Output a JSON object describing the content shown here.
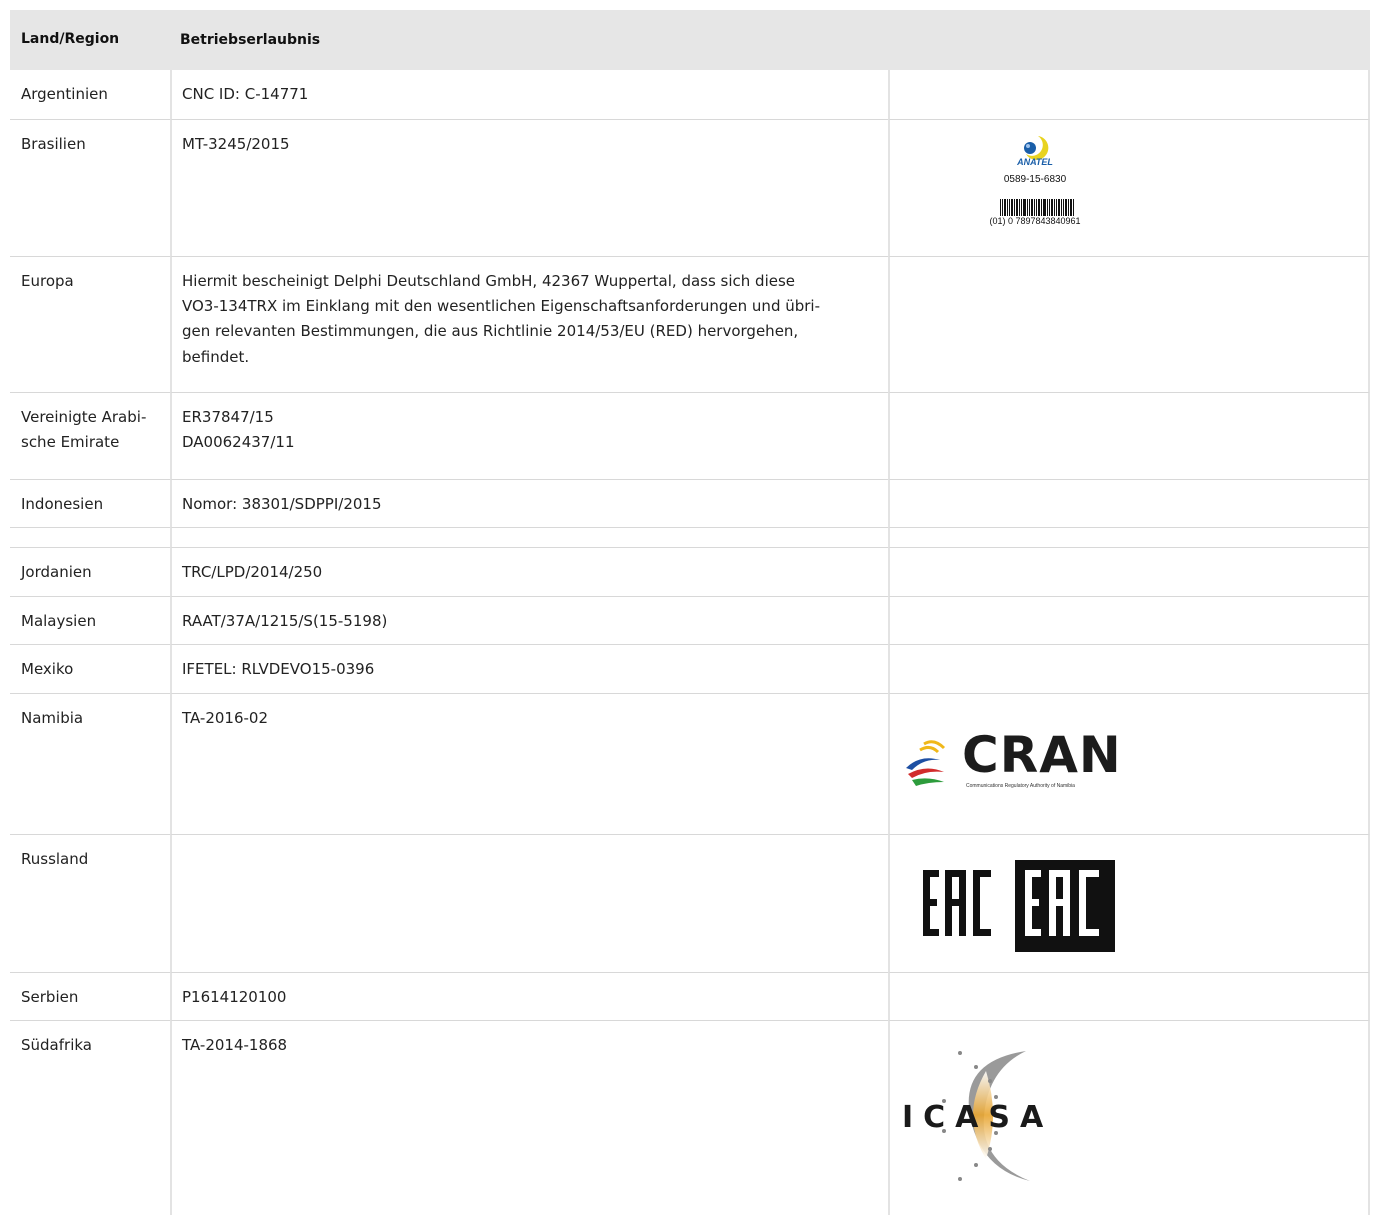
{
  "header": {
    "col1": "Land/Region",
    "col2": "Betriebserlaubnis"
  },
  "rows": [
    {
      "country": "Argentinien",
      "permit": [
        "CNC ID: C-14771"
      ]
    },
    {
      "country": "Brasilien",
      "permit": [
        "MT-3245/2015"
      ]
    },
    {
      "country": "Europa",
      "permit": [
        "Hiermit bescheinigt Delphi Deutschland GmbH, 42367 Wuppertal, dass sich diese",
        "VO3-134TRX im Einklang mit den wesentlichen Eigenschaftsanforderungen und übri-",
        "gen relevanten Bestimmungen, die aus Richtlinie 2014/53/EU (RED) hervorgehen,",
        "befindet."
      ]
    },
    {
      "country_lines": [
        "Vereinigte Arabi-",
        "sche Emirate"
      ],
      "permit": [
        "ER37847/15",
        "DA0062437/11"
      ]
    },
    {
      "country": "Indonesien",
      "permit": [
        "Nomor: 38301/SDPPI/2015"
      ]
    },
    {
      "country": "Jordanien",
      "permit": [
        "TRC/LPD/2014/250"
      ]
    },
    {
      "country": "Malaysien",
      "permit": [
        "RAAT/37A/1215/S(15-5198)"
      ]
    },
    {
      "country": "Mexiko",
      "permit": [
        "IFETEL: RLVDEVO15-0396"
      ]
    },
    {
      "country": "Namibia",
      "permit": [
        "TA-2016-02"
      ]
    },
    {
      "country": "Russland",
      "permit": []
    },
    {
      "country": "Serbien",
      "permit": [
        "P1614120100"
      ]
    },
    {
      "country": "Südafrika",
      "permit": [
        "TA-2014-1868"
      ]
    }
  ],
  "logos": {
    "anatel": {
      "brand": "ANATEL",
      "number": "0589-15-6830",
      "barcode": "(01) 0 7897843840961",
      "color": "#1a5ea8"
    },
    "cran": {
      "brand": "CRAN",
      "subtitle": "Communications Regulatory Authority of Namibia"
    },
    "eac": {
      "text": "EAC"
    },
    "icasa": {
      "text": "ICASA"
    }
  }
}
